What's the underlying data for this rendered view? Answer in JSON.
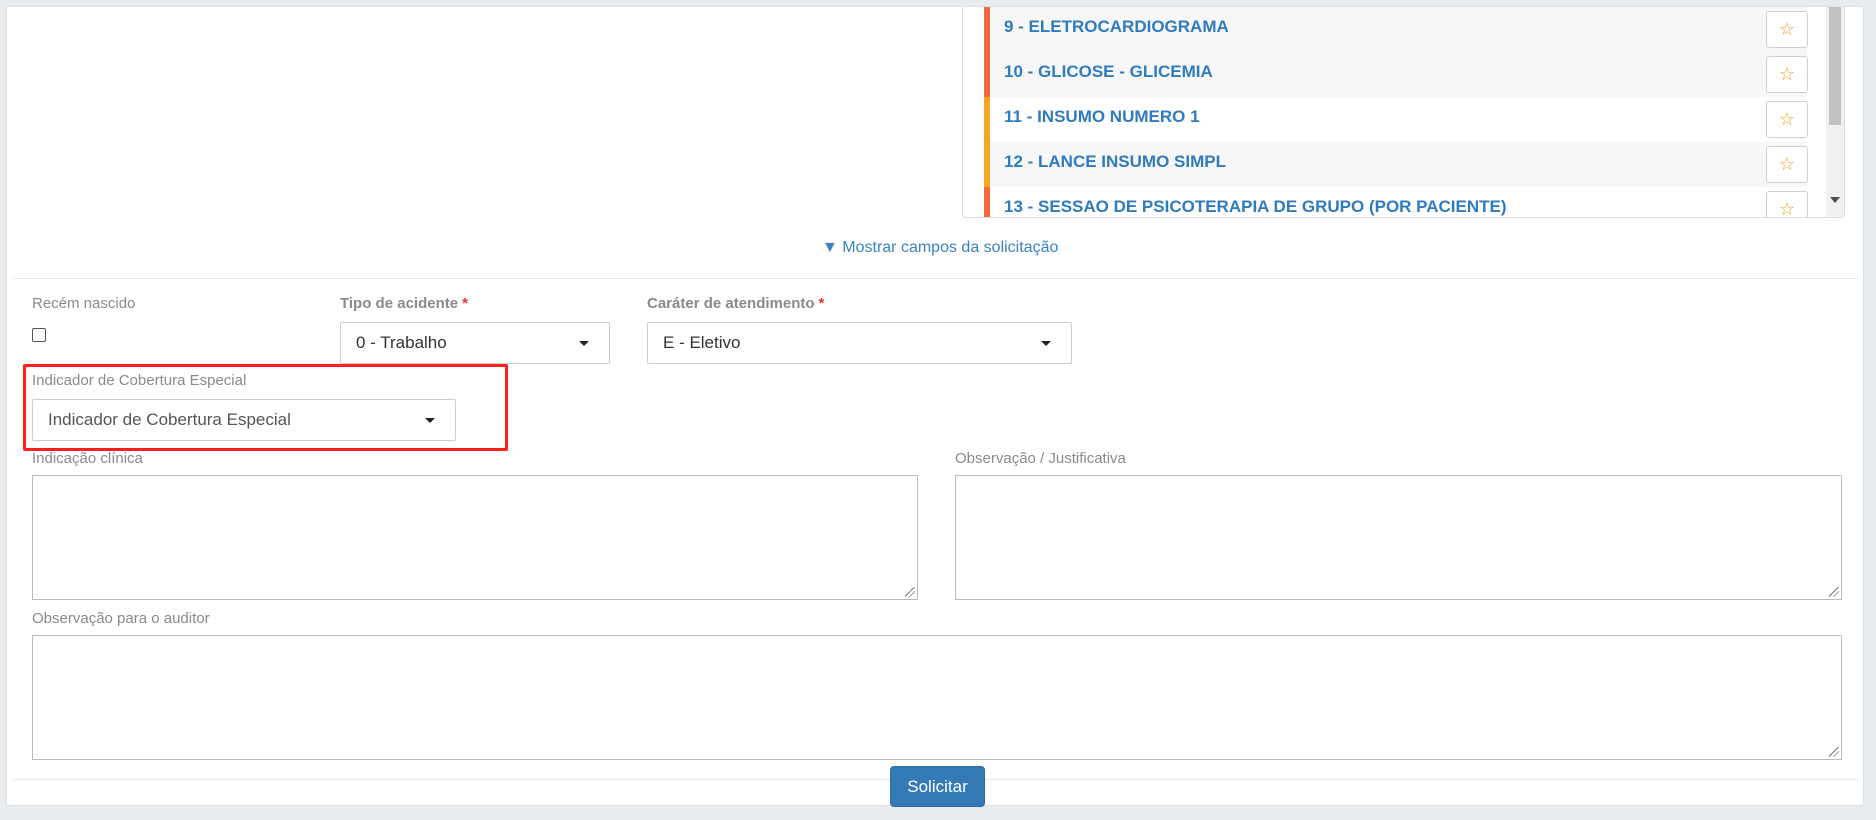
{
  "procedures": [
    {
      "label": "9 - ELETROCARDIOGRAMA",
      "color": "#f26a3d"
    },
    {
      "label": "10 - GLICOSE - GLICEMIA",
      "color": "#f26a3d"
    },
    {
      "label": "11 - INSUMO NUMERO 1",
      "color": "#f5a623"
    },
    {
      "label": "12 - LANCE INSUMO SIMPL",
      "color": "#f5a623"
    },
    {
      "label": "13 - SESSAO DE PSICOTERAPIA DE GRUPO (POR PACIENTE)",
      "color": "#f26a3d"
    }
  ],
  "star_glyph": "☆",
  "toggle_link": "▼ Mostrar campos da solicitação",
  "form": {
    "recem_nascido_label": "Recém nascido",
    "tipo_acidente_label": "Tipo de acidente",
    "tipo_acidente_value": "0 - Trabalho",
    "carater_label": "Caráter de atendimento",
    "carater_value": "E - Eletivo",
    "required_mark": "*",
    "indicador_label": "Indicador de Cobertura Especial",
    "indicador_placeholder": "Indicador de Cobertura Especial",
    "indicacao_label": "Indicação clínica",
    "observacao_label": "Observação / Justificativa",
    "auditor_label": "Observação para o auditor"
  },
  "submit_label": "Solicitar",
  "colors": {
    "primary": "#337ab7",
    "link": "#2f7bbf",
    "highlight": "#ff1f1f"
  }
}
